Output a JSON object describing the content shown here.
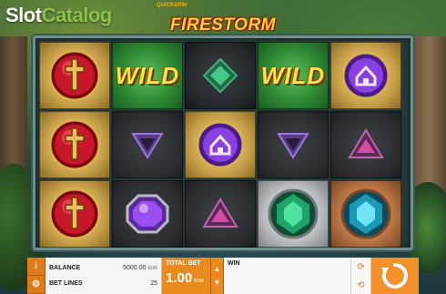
{
  "branding": {
    "site_logo_a": "Slot",
    "site_logo_b": "Catalog",
    "provider": "QUICKSPIN",
    "game_title": "FIRESTORM"
  },
  "reels": {
    "rows": [
      [
        "cross-gem-red",
        "wild-green",
        "diamond-green-dark",
        "wild-green",
        "house-gem-purple"
      ],
      [
        "cross-gem-red",
        "triangle-down-purple-dark",
        "house-gem-purple",
        "triangle-down-purple-dark",
        "triangle-up-magenta-dark"
      ],
      [
        "cross-gem-red",
        "octagon-gem-purple",
        "triangle-up-magenta-dark",
        "gem-green-silver",
        "gem-teal-copper"
      ]
    ],
    "wild_label": "WILD"
  },
  "controls": {
    "balance_label": "BALANCE",
    "balance_value": "5000.00",
    "balance_currency": "EUR",
    "bet_lines_label": "BET LINES",
    "bet_lines_value": "25",
    "total_bet_label": "TOTAL BET",
    "total_bet_value": "1.00",
    "total_bet_currency": "EUR",
    "win_label": "WIN",
    "info_icon": "info-icon",
    "settings_icon": "gear-icon",
    "autoplay_icon": "autoplay-icon",
    "spin_icon": "spin-arrow-icon"
  },
  "colors": {
    "accent_orange": "#e98a1e",
    "frame": "#6f8f8f",
    "wild_yellow": "#ffe14a"
  }
}
